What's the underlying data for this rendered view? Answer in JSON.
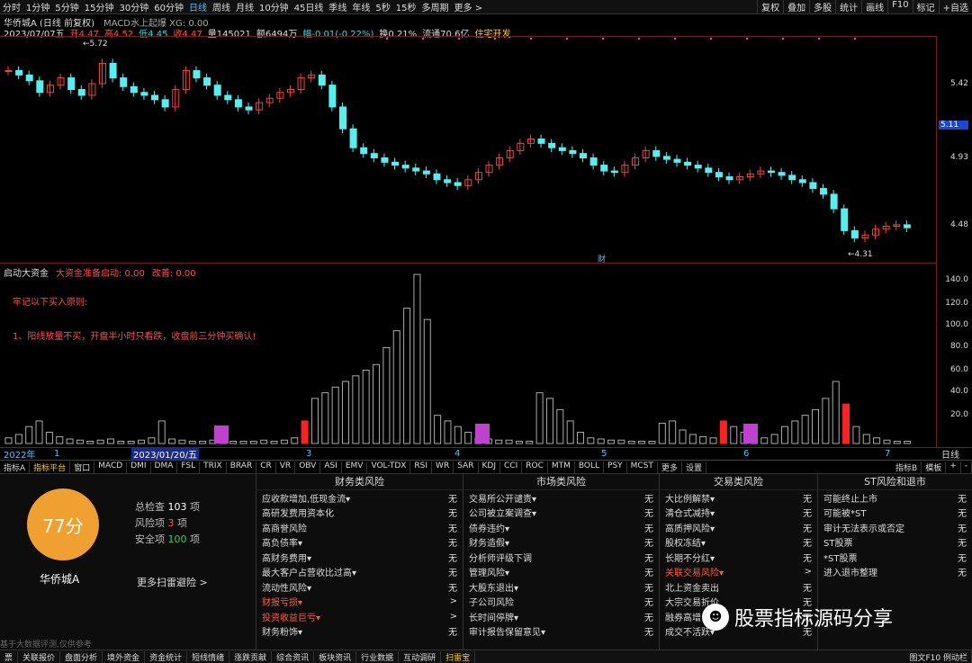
{
  "topbar": {
    "periods": [
      "分时",
      "1分钟",
      "5分钟",
      "15分钟",
      "30分钟",
      "60分钟",
      "日线",
      "周线",
      "月线",
      "10分钟",
      "45日线",
      "季线",
      "年线",
      "5秒",
      "15秒",
      "多周期",
      "更多 >"
    ],
    "selected": "日线",
    "right": [
      "复权",
      "叠加",
      "多股",
      "统计",
      "画线",
      "F10",
      "标记",
      "+自选"
    ]
  },
  "info": {
    "title": "华侨城A (日线 前复权)",
    "indicator": "MACD水上起爆 XG: 0.00",
    "date": "2023/07/07五",
    "open": "开4.47",
    "high": "高4.52",
    "low": "低4.45",
    "close": "收4.47",
    "volume": "量145021",
    "amount": "额6494万",
    "change": "幅-0.01(-0.22%)",
    "turnover": "换0.21%",
    "float": "流通70.6亿",
    "sector": "住宅开发"
  },
  "price_axis": [
    "5.42",
    "5.11",
    "4.93",
    "4.48"
  ],
  "price_marks": {
    "high": "5.72",
    "low": "4.31",
    "fin": "财"
  },
  "ind": {
    "name": "启动大资金",
    "line1": "大资金准备启动: 0.00",
    "line2": "改善: 0.00",
    "note1": "牢记以下买入原则:",
    "note2": "1、阳线放量不买，开盘半小时只看跌，收盘前三分钟买确认!"
  },
  "ind_axis": [
    "140.0",
    "120.0",
    "100.0",
    "80.0",
    "60.0",
    "40.0",
    "20.0"
  ],
  "xaxis": {
    "year": "2022年",
    "date": "2023/01/20/五",
    "ticks": [
      "1",
      "2",
      "3",
      "4",
      "5",
      "6",
      "7"
    ],
    "right": "日线"
  },
  "tabs": [
    "指标A",
    "指标平台",
    "窗口",
    "MACD",
    "DMI",
    "DMA",
    "FSL",
    "TRIX",
    "BRAR",
    "CR",
    "VR",
    "OBV",
    "ASI",
    "EMV",
    "VOL-TDX",
    "RSI",
    "WR",
    "SAR",
    "KDJ",
    "CCI",
    "ROC",
    "MTM",
    "BOLL",
    "PSY",
    "MCST",
    "更多",
    "设置"
  ],
  "tabs_right": [
    "指标B",
    "模板",
    "+",
    "-"
  ],
  "risk": {
    "score": "77分",
    "stock": "华侨城A",
    "total_l": "总检查",
    "total_v": "103",
    "risk_l": "风险项",
    "risk_v": "3",
    "safe_l": "安全项",
    "safe_v": "100",
    "unit": "项",
    "more": "更多扫雷避险 >",
    "disclaimer": "基于大数据评测,仅供参考",
    "cols": [
      {
        "title": "财务类风险",
        "items": [
          [
            "应收款增加,低现金流▾",
            "无"
          ],
          [
            "高研发费用资本化",
            "无"
          ],
          [
            "高商誉风险",
            "无"
          ],
          [
            "高负债率▾",
            "无"
          ],
          [
            "高财务费用▾",
            "无"
          ],
          [
            "最大客户占营收比过高▾",
            "无"
          ],
          [
            "流动性风险▾",
            "无"
          ],
          [
            "财报亏损▾",
            ">"
          ],
          [
            "投资收益巨亏▾",
            ">"
          ],
          [
            "财务粉饰▾",
            "无"
          ]
        ]
      },
      {
        "title": "市场类风险",
        "items": [
          [
            "交易所公开谴责▾",
            "无"
          ],
          [
            "公司被立案调查▾",
            "无"
          ],
          [
            "债券违约▾",
            "无"
          ],
          [
            "财务造假▾",
            "无"
          ],
          [
            "分析师评级下调",
            "无"
          ],
          [
            "管理风险▾",
            "无"
          ],
          [
            "大股东退出▾",
            "无"
          ],
          [
            "子公司风险",
            "无"
          ],
          [
            "长时间停牌▾",
            "无"
          ],
          [
            "审计报告保留意见▾",
            "无"
          ]
        ]
      },
      {
        "title": "交易类风险",
        "items": [
          [
            "大比例解禁▾",
            "无"
          ],
          [
            "清仓式减持▾",
            "无"
          ],
          [
            "高质押风险▾",
            "无"
          ],
          [
            "股权冻结▾",
            "无"
          ],
          [
            "长期不分红▾",
            "无"
          ],
          [
            "关联交易风险▾",
            ">"
          ],
          [
            "北上资金卖出",
            "无"
          ],
          [
            "大宗交易折价",
            "无"
          ],
          [
            "融券高增",
            "无"
          ],
          [
            "成交不活跃▾",
            "无"
          ]
        ]
      },
      {
        "title": "ST风险和退市",
        "items": [
          [
            "可能终止上市",
            "无"
          ],
          [
            "可能被*ST",
            "无"
          ],
          [
            "审计无法表示或否定",
            "无"
          ],
          [
            "ST股票",
            "无"
          ],
          [
            "*ST股票",
            "无"
          ],
          [
            "进入退市整理",
            "无"
          ]
        ]
      }
    ]
  },
  "bottom": [
    "票",
    "关联报价",
    "盘面分析",
    "境外资金",
    "资金统计",
    "短线情绪",
    "涨跌贡献",
    "综合资讯",
    "板块资讯",
    "行业数据",
    "互动调研",
    "扫雷宝"
  ],
  "bottom_right": "图文F10 例动栏",
  "watermark": "股票指标源码分享",
  "chart_data": {
    "type": "candlestick",
    "ylim": [
      4.31,
      5.72
    ],
    "series": [
      {
        "name": "price",
        "values": [
          5.55,
          5.52,
          5.48,
          5.4,
          5.45,
          5.5,
          5.42,
          5.38,
          5.46,
          5.6,
          5.5,
          5.44,
          5.4,
          5.38,
          5.35,
          5.3,
          5.42,
          5.55,
          5.5,
          5.45,
          5.38,
          5.35,
          5.3,
          5.28,
          5.33,
          5.36,
          5.4,
          5.42,
          5.5,
          5.52,
          5.45,
          5.3,
          5.15,
          5.02,
          4.98,
          4.95,
          4.92,
          4.9,
          4.88,
          4.86,
          4.84,
          4.8,
          4.78,
          4.76,
          4.8,
          4.85,
          4.9,
          4.95,
          5.0,
          5.05,
          5.08,
          5.05,
          5.02,
          5.0,
          4.98,
          4.95,
          4.9,
          4.86,
          4.85,
          4.9,
          4.95,
          5.0,
          4.96,
          4.94,
          4.92,
          4.9,
          4.88,
          4.85,
          4.82,
          4.8,
          4.82,
          4.84,
          4.86,
          4.85,
          4.83,
          4.8,
          4.78,
          4.74,
          4.7,
          4.6,
          4.45,
          4.4,
          4.42,
          4.46,
          4.48,
          4.49,
          4.47
        ]
      },
      {
        "name": "volume",
        "values": [
          5,
          8,
          15,
          20,
          10,
          6,
          4,
          3,
          2,
          3,
          4,
          2,
          2,
          3,
          5,
          20,
          4,
          3,
          2,
          2,
          3,
          2,
          2,
          2,
          2,
          3,
          2,
          3,
          5,
          20,
          40,
          45,
          50,
          55,
          60,
          65,
          70,
          85,
          100,
          120,
          150,
          110,
          25,
          20,
          15,
          10,
          5,
          4,
          3,
          3,
          2,
          2,
          45,
          40,
          30,
          20,
          10,
          5,
          4,
          3,
          3,
          2,
          2,
          2,
          18,
          20,
          12,
          8,
          6,
          5,
          20,
          15,
          10,
          6,
          5,
          8,
          15,
          20,
          25,
          30,
          40,
          55,
          35,
          15,
          8,
          5,
          3,
          2,
          2
        ]
      }
    ]
  }
}
